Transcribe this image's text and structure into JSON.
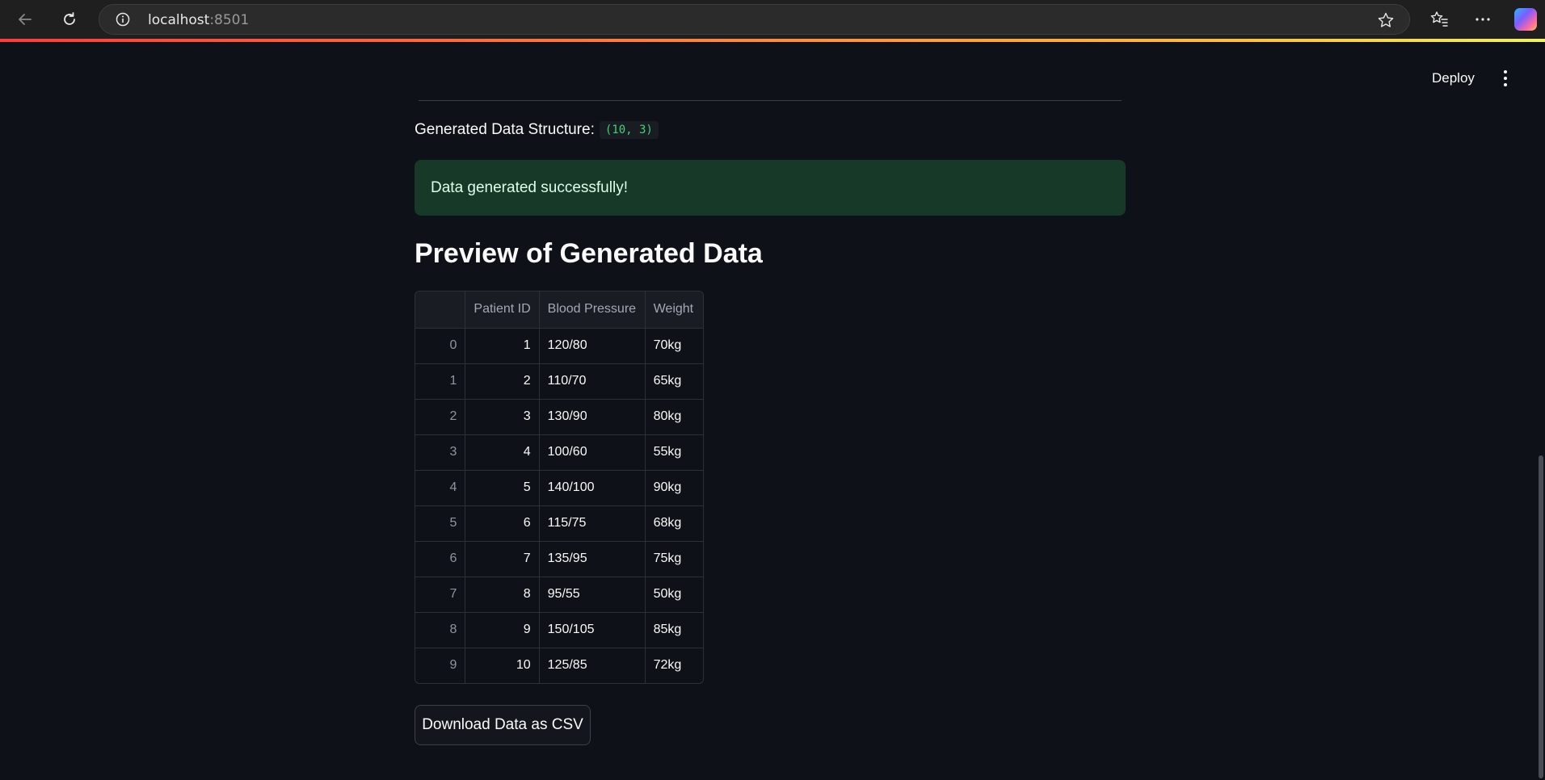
{
  "browser": {
    "url_host": "localhost",
    "url_port": ":8501",
    "icons": [
      "back-icon",
      "refresh-icon",
      "info-icon",
      "star-icon",
      "favorites-icon",
      "more-icon",
      "copilot-icon"
    ]
  },
  "toolbar": {
    "deploy_label": "Deploy"
  },
  "structure": {
    "label": "Generated Data Structure:",
    "value": "(10, 3)"
  },
  "success": {
    "message": "Data generated successfully!",
    "color": "#173928"
  },
  "preview": {
    "heading": "Preview of Generated Data",
    "columns": [
      "Patient ID",
      "Blood Pressure",
      "Weight"
    ],
    "rows": [
      {
        "index": "0",
        "patient_id": "1",
        "blood_pressure": "120/80",
        "weight": "70kg"
      },
      {
        "index": "1",
        "patient_id": "2",
        "blood_pressure": "110/70",
        "weight": "65kg"
      },
      {
        "index": "2",
        "patient_id": "3",
        "blood_pressure": "130/90",
        "weight": "80kg"
      },
      {
        "index": "3",
        "patient_id": "4",
        "blood_pressure": "100/60",
        "weight": "55kg"
      },
      {
        "index": "4",
        "patient_id": "5",
        "blood_pressure": "140/100",
        "weight": "90kg"
      },
      {
        "index": "5",
        "patient_id": "6",
        "blood_pressure": "115/75",
        "weight": "68kg"
      },
      {
        "index": "6",
        "patient_id": "7",
        "blood_pressure": "135/95",
        "weight": "75kg"
      },
      {
        "index": "7",
        "patient_id": "8",
        "blood_pressure": "95/55",
        "weight": "50kg"
      },
      {
        "index": "8",
        "patient_id": "9",
        "blood_pressure": "150/105",
        "weight": "85kg"
      },
      {
        "index": "9",
        "patient_id": "10",
        "blood_pressure": "125/85",
        "weight": "72kg"
      }
    ]
  },
  "download": {
    "label": "Download Data as CSV"
  },
  "colors": {
    "background": "#0e1117",
    "code_text": "#3dd56d"
  }
}
